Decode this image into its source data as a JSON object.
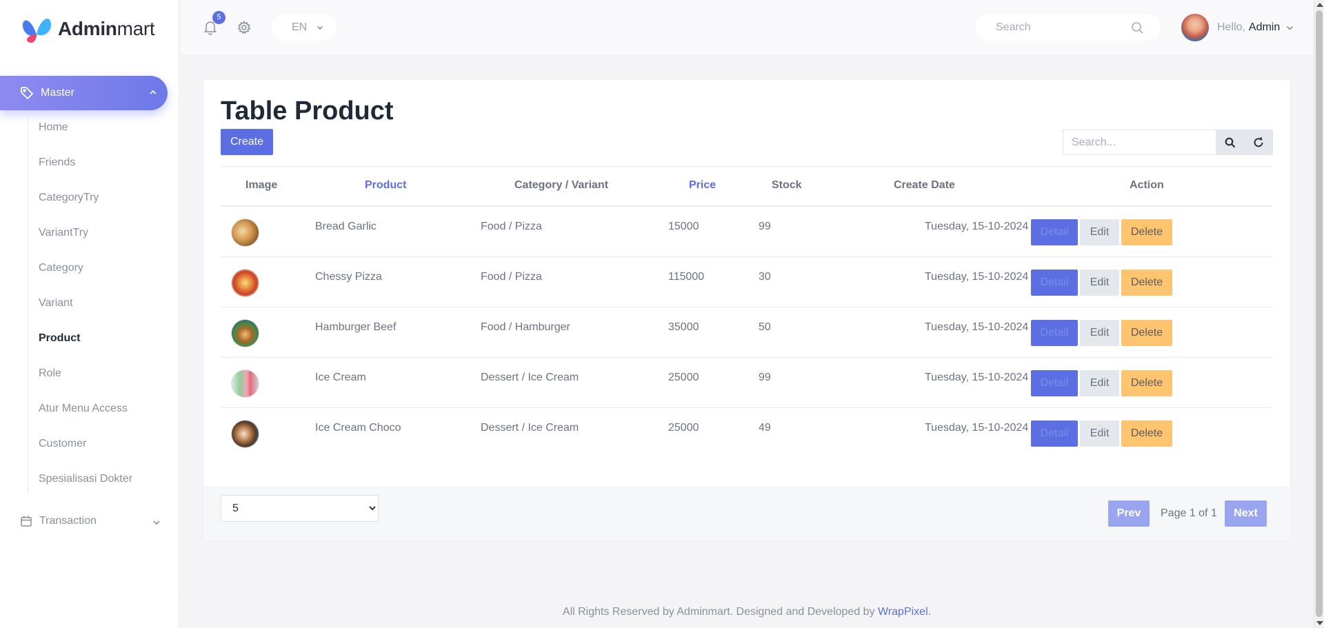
{
  "app": {
    "brand_bold": "Admin",
    "brand_light": "mart"
  },
  "sidebar": {
    "master_label": "Master",
    "items": [
      {
        "label": "Home"
      },
      {
        "label": "Friends"
      },
      {
        "label": "CategoryTry"
      },
      {
        "label": "VariantTry"
      },
      {
        "label": "Category"
      },
      {
        "label": "Variant"
      },
      {
        "label": "Product",
        "active": true
      },
      {
        "label": "Role"
      },
      {
        "label": "Atur Menu Access"
      },
      {
        "label": "Customer"
      },
      {
        "label": "Spesialisasi Dokter"
      }
    ],
    "transaction_label": "Transaction"
  },
  "topbar": {
    "notification_count": "5",
    "language": "EN",
    "search_placeholder": "Search",
    "greeting": "Hello,",
    "username": "Admin"
  },
  "page": {
    "title": "Table Product",
    "create_label": "Create",
    "search_placeholder": "Search..."
  },
  "table": {
    "headers": {
      "image": "Image",
      "product": "Product",
      "category": "Category / Variant",
      "price": "Price",
      "stock": "Stock",
      "date": "Create Date",
      "action": "Action"
    },
    "rows": [
      {
        "product": "Bread Garlic",
        "category": "Food / Pizza",
        "price": "15000",
        "stock": "99",
        "date": "Tuesday, 15-10-2024"
      },
      {
        "product": "Chessy Pizza",
        "category": "Food / Pizza",
        "price": "115000",
        "stock": "30",
        "date": "Tuesday, 15-10-2024"
      },
      {
        "product": "Hamburger Beef",
        "category": "Food / Hamburger",
        "price": "35000",
        "stock": "50",
        "date": "Tuesday, 15-10-2024"
      },
      {
        "product": "Ice Cream",
        "category": "Dessert / Ice Cream",
        "price": "25000",
        "stock": "99",
        "date": "Tuesday, 15-10-2024"
      },
      {
        "product": "Ice Cream Choco",
        "category": "Dessert / Ice Cream",
        "price": "25000",
        "stock": "49",
        "date": "Tuesday, 15-10-2024"
      }
    ],
    "actions": {
      "detail": "Detail",
      "edit": "Edit",
      "delete": "Delete"
    }
  },
  "pagination": {
    "page_size": "5",
    "prev": "Prev",
    "info": "Page 1 of 1",
    "next": "Next"
  },
  "footer": {
    "text": "All Rights Reserved by Adminmart. Designed and Developed by ",
    "link": "WrapPixel",
    "end": "."
  },
  "colors": {
    "accent": "#5b6fe2",
    "warning": "#ffc470",
    "muted": "#e4e7ec"
  }
}
